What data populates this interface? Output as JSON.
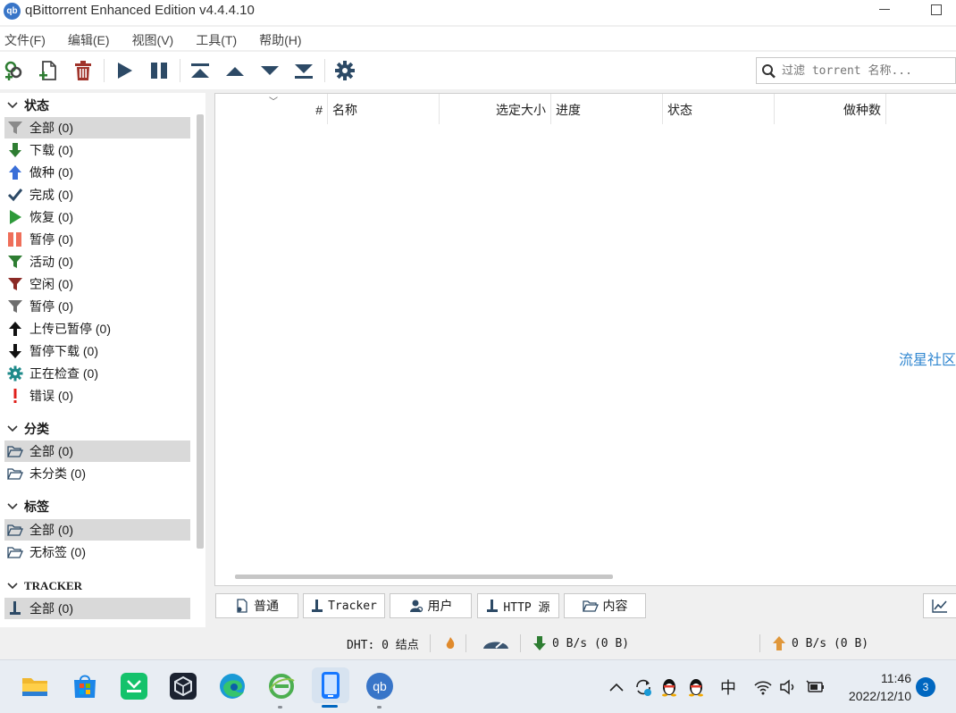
{
  "window": {
    "title": "qBittorrent Enhanced Edition v4.4.4.10",
    "icon_text": "qb"
  },
  "menu": [
    "文件(F)",
    "编辑(E)",
    "视图(V)",
    "工具(T)",
    "帮助(H)"
  ],
  "toolbar": {
    "buttons": [
      "add-torrent-link-icon",
      "add-torrent-file-icon",
      "delete-icon",
      "resume-icon",
      "pause-icon",
      "move-top-icon",
      "move-up-icon",
      "move-down-icon",
      "move-bottom-icon",
      "options-gear-icon"
    ],
    "search_placeholder": "过滤 torrent 名称..."
  },
  "sidebar": {
    "status_header": "状态",
    "status_items": [
      {
        "label": "全部 (0)",
        "icon": "filter-gray-icon"
      },
      {
        "label": "下载 (0)",
        "icon": "download-arrow-icon"
      },
      {
        "label": "做种 (0)",
        "icon": "upload-arrow-icon"
      },
      {
        "label": "完成 (0)",
        "icon": "checkmark-icon"
      },
      {
        "label": "恢复 (0)",
        "icon": "play-icon"
      },
      {
        "label": "暂停 (0)",
        "icon": "pause-red-icon"
      },
      {
        "label": "活动 (0)",
        "icon": "filter-green-icon"
      },
      {
        "label": "空闲 (0)",
        "icon": "filter-red-icon"
      },
      {
        "label": "暂停 (0)",
        "icon": "filter-gray-icon"
      },
      {
        "label": "上传已暂停 (0)",
        "icon": "up-black-arrow-icon"
      },
      {
        "label": "暂停下载 (0)",
        "icon": "down-black-arrow-icon"
      },
      {
        "label": "正在检查 (0)",
        "icon": "gear-teal-icon"
      },
      {
        "label": "错误 (0)",
        "icon": "error-exclamation-icon"
      }
    ],
    "category_header": "分类",
    "category_items": [
      "全部 (0)",
      "未分类 (0)"
    ],
    "tag_header": "标签",
    "tag_items": [
      "全部 (0)",
      "无标签 (0)"
    ],
    "tracker_header": "TRACKER",
    "tracker_items": [
      "全部 (0)"
    ]
  },
  "table": {
    "columns": [
      "#",
      "名称",
      "选定大小",
      "进度",
      "状态",
      "做种数"
    ],
    "watermark": "流星社区"
  },
  "bottom_tabs": [
    "普通",
    "Tracker",
    "用户",
    "HTTP 源",
    "内容"
  ],
  "statusbar": {
    "dht": "DHT: 0 结点",
    "download": "0 B/s (0 B)",
    "upload": "0 B/s (0 B)"
  },
  "taskbar": {
    "apps": [
      "file-explorer-icon",
      "microsoft-store-icon",
      "wechat-like-icon",
      "virtualbox-icon",
      "edge-icon",
      "browser-e-icon",
      "phone-link-icon",
      "qbittorrent-icon"
    ],
    "tray_ime": "中",
    "time": "11:46",
    "date": "2022/12/10",
    "notifications": "3"
  },
  "colors": {
    "accent": "#0067c0",
    "watermark": "#2f86d0",
    "download_green": "#2e7d32",
    "upload_orange": "#e08a2c"
  }
}
